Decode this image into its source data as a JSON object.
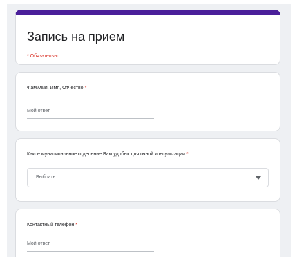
{
  "form": {
    "title": "Запись на прием",
    "required_note": "* Обязательно",
    "accent_color": "#4a1f9a"
  },
  "questions": [
    {
      "label": "Фамилия, Имя, Отчество",
      "required_mark": "*",
      "placeholder": "Мой ответ"
    },
    {
      "label": "Какое муниципальное отделение Вам удобно для очной консультации",
      "required_mark": "*",
      "selected": "Выбрать",
      "icon": "chevron-down-icon"
    },
    {
      "label": "Контактный телефон",
      "required_mark": "*",
      "placeholder": "Мой ответ"
    }
  ]
}
